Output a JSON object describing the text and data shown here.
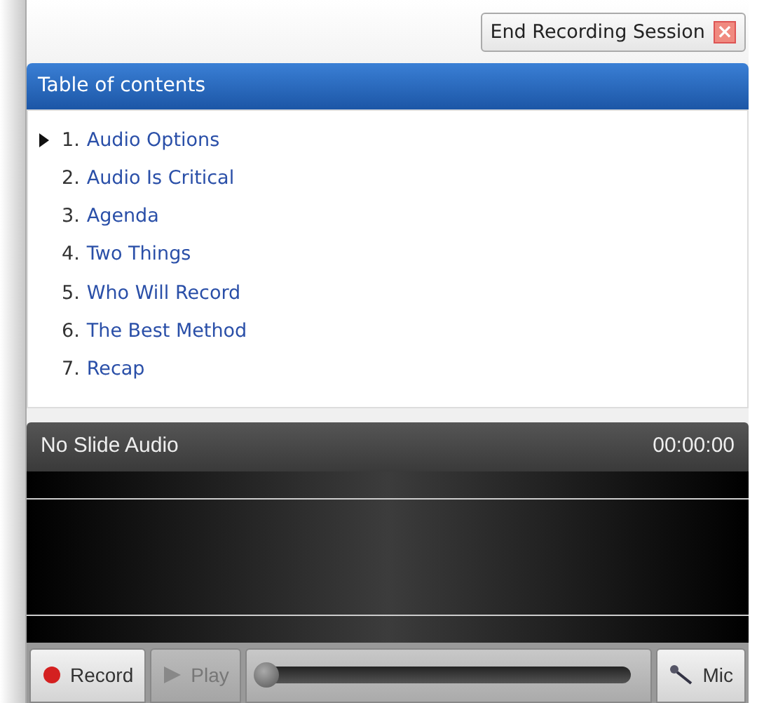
{
  "end_session_button": {
    "label": "End Recording Session",
    "close_icon": "×"
  },
  "toc": {
    "title": "Table of contents",
    "items": [
      {
        "number": "1.",
        "title": "Audio Options",
        "selected": true
      },
      {
        "number": "2.",
        "title": "Audio Is Critical",
        "selected": false
      },
      {
        "number": "3.",
        "title": "Agenda",
        "selected": false
      },
      {
        "number": "4.",
        "title": "Two Things",
        "selected": false
      },
      {
        "number": "5.",
        "title": "Who Will Record",
        "selected": false
      },
      {
        "number": "6.",
        "title": "The Best Method",
        "selected": false
      },
      {
        "number": "7.",
        "title": "Recap",
        "selected": false
      }
    ]
  },
  "audio": {
    "status": "No Slide Audio",
    "time": "00:00:00"
  },
  "toolbar": {
    "record": {
      "label": "Record",
      "disabled": false
    },
    "play": {
      "label": "Play",
      "disabled": true
    },
    "seek": {
      "level": 0
    },
    "mic": {
      "label": "Mic",
      "disabled": false
    }
  }
}
